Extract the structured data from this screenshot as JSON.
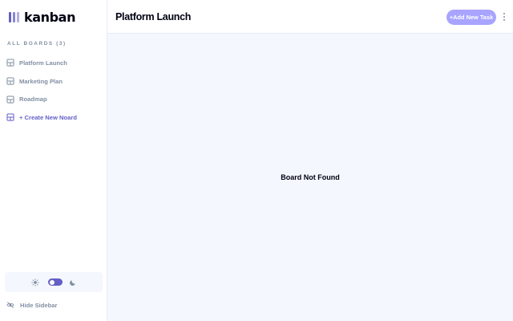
{
  "app": {
    "logo_text": "kanban"
  },
  "sidebar": {
    "heading": "ALL BOARDS (3)",
    "boards": [
      {
        "label": "Platform Launch"
      },
      {
        "label": "Marketing Plan"
      },
      {
        "label": "Roadmap"
      }
    ],
    "create_label": "+ Create New Noard",
    "theme": {
      "mode": "light",
      "sun_icon": "sun-icon",
      "moon_icon": "moon-icon"
    },
    "hide_label": "Hide Sidebar"
  },
  "header": {
    "title": "Platform Launch",
    "add_task_label": "+Add New Task",
    "menu_icon": "vertical-ellipsis-icon"
  },
  "main": {
    "message": "Board Not Found"
  },
  "colors": {
    "accent": "#635fc7",
    "accent_light": "#a8a4ff",
    "muted": "#828fa3",
    "background": "#f4f7fd",
    "border": "#e4ebfa"
  }
}
